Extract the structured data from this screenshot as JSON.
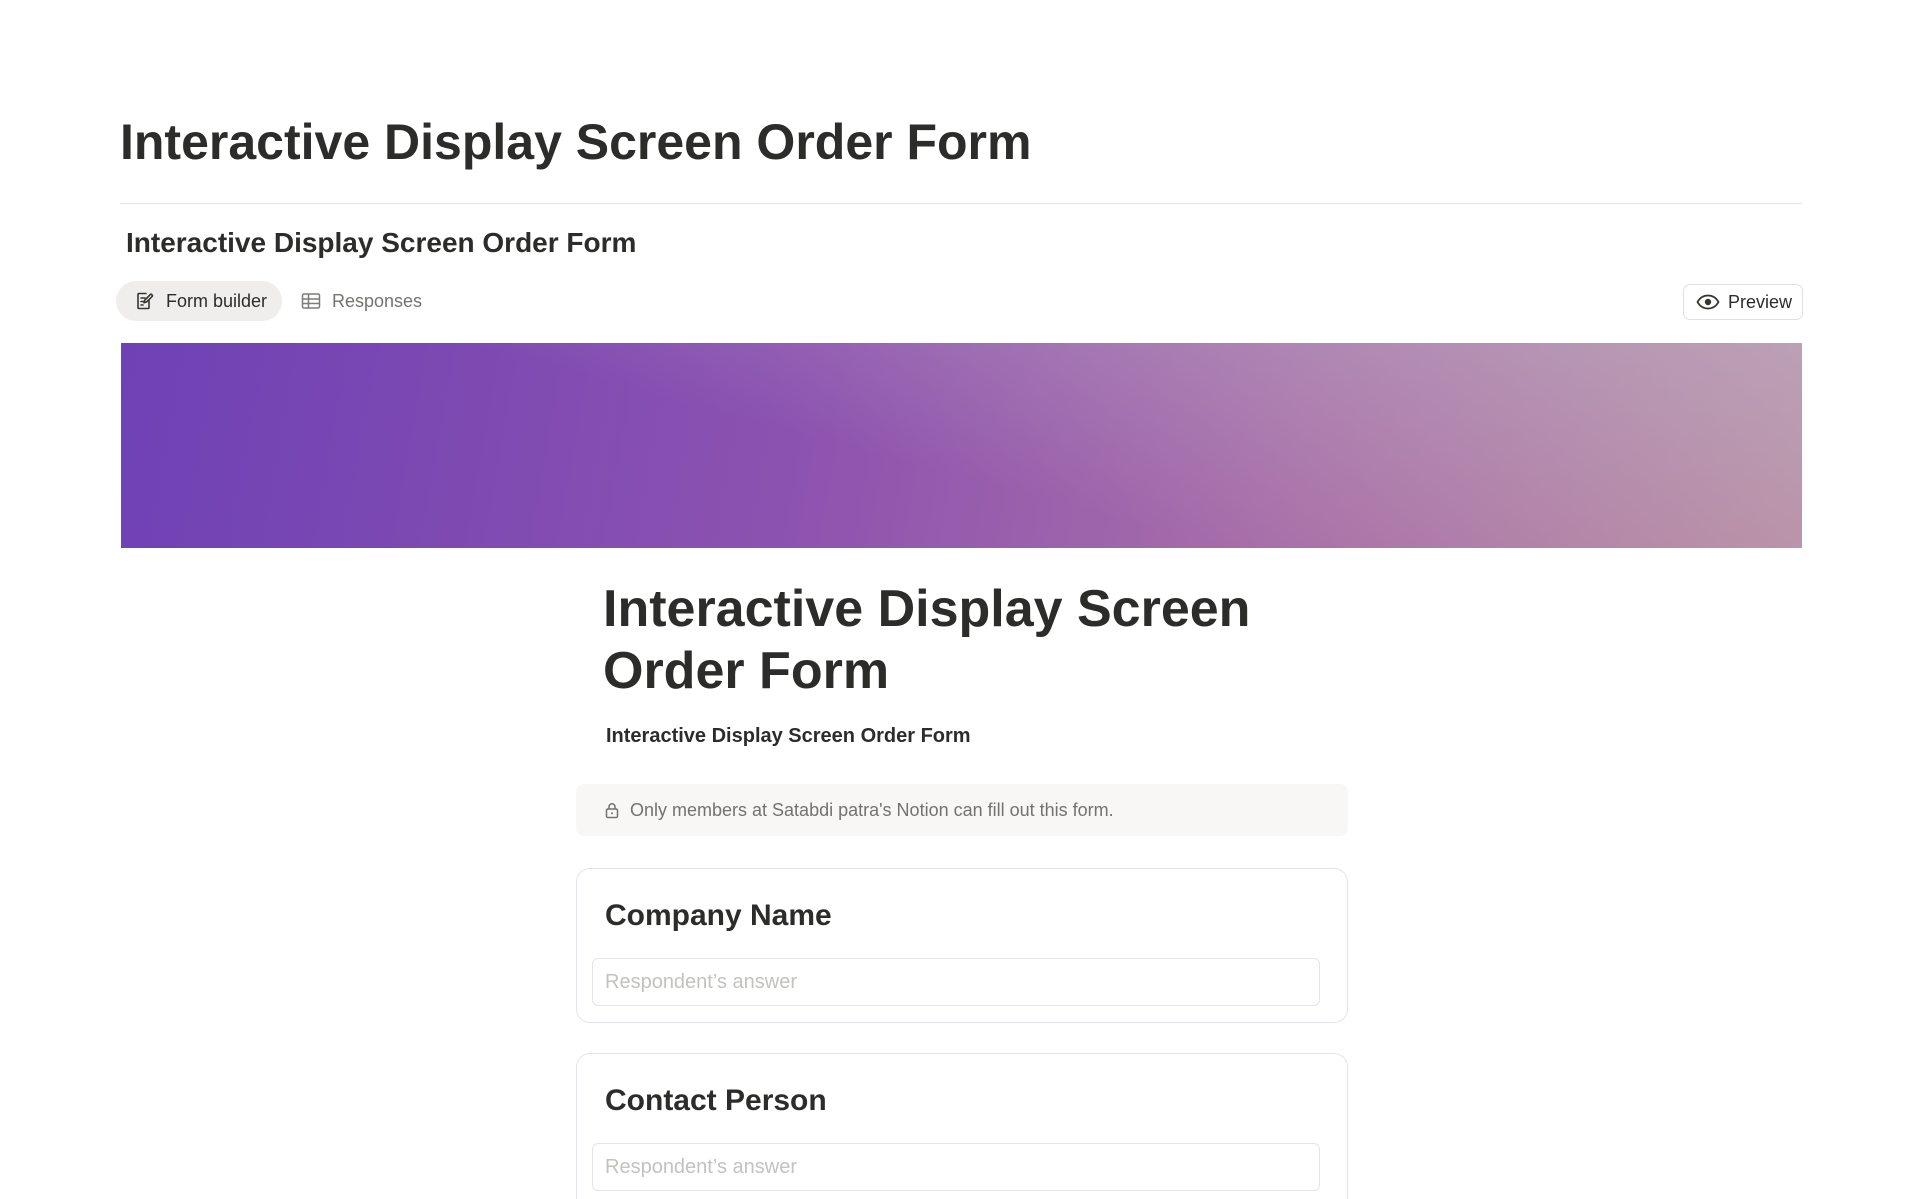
{
  "page": {
    "title": "Interactive Display Screen Order Form"
  },
  "database": {
    "title": "Interactive Display Screen Order Form"
  },
  "views": {
    "form_builder_label": "Form builder",
    "responses_label": "Responses",
    "active": "Form builder"
  },
  "toolbar": {
    "preview_label": "Preview"
  },
  "cover": {
    "gradient_colors": [
      "#6e41b5",
      "#8c52b0",
      "#a96fa8",
      "#b98a9f"
    ]
  },
  "form": {
    "title": "Interactive Display Screen Order Form",
    "description": "Interactive Display Screen Order Form",
    "access_notice": "Only members at Satabdi patra's Notion can fill out this form.",
    "questions": [
      {
        "label": "Company Name",
        "placeholder": "Respondent’s answer"
      },
      {
        "label": "Contact Person",
        "placeholder": "Respondent’s answer"
      }
    ]
  },
  "icons": {
    "form_builder": "edit-form-icon",
    "responses": "table-icon",
    "preview": "eye-icon",
    "access": "lock-icon"
  }
}
